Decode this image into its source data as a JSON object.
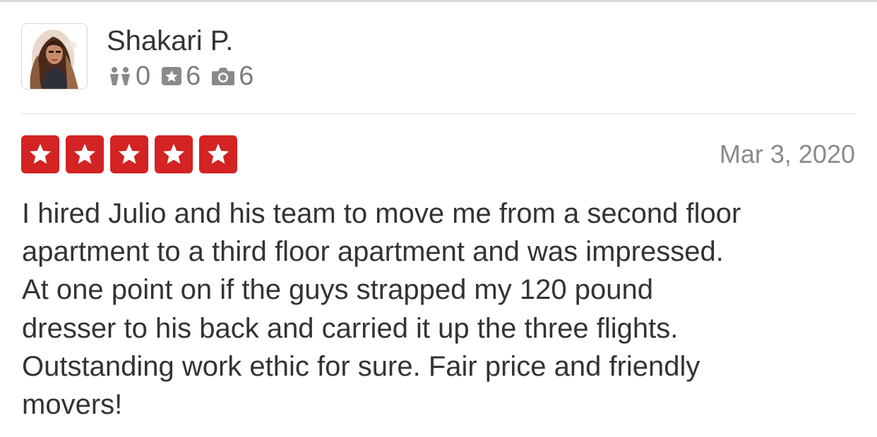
{
  "review": {
    "user": {
      "name": "Shakari P.",
      "avatar": "user-profile-photo",
      "stats": [
        {
          "icon": "friends-icon",
          "value": "0"
        },
        {
          "icon": "review-star-icon",
          "value": "6"
        },
        {
          "icon": "camera-icon",
          "value": "6"
        }
      ]
    },
    "rating": {
      "stars": 5,
      "max": 5,
      "color": "#d32323"
    },
    "date": "Mar 3, 2020",
    "text": "I hired Julio and his team to move me from a second floor\napartment to a third floor apartment and was impressed.\nAt one point on if the guys strapped my 120 pound\ndresser to his back and carried it up the three flights.\nOutstanding work ethic for sure. Fair price and friendly\nmovers!"
  },
  "colors": {
    "star_fill": "#d32323",
    "text": "#333333",
    "muted": "#7d7d7d",
    "date": "#8a8a8a"
  }
}
